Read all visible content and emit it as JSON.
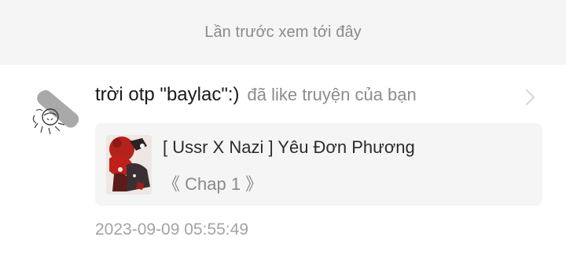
{
  "divider": {
    "last_seen_label": "Lần trước xem tới đây"
  },
  "notification": {
    "username": "trời otp \"baylac\":)",
    "action": "đã like truyện của bạn",
    "avatar_icon": "sketch-avatar-icon",
    "chevron_icon": "chevron-right-icon",
    "story": {
      "title": "[ Ussr X Nazi ] Yêu Đơn Phương",
      "chapter": "《 Chap 1 》",
      "cover_icon": "story-cover-image"
    },
    "timestamp": "2023-09-09 05:55:49"
  },
  "colors": {
    "divider_bg": "#f5f5f5",
    "card_bg": "#f5f5f5",
    "primary_text": "#1a1a1a",
    "secondary_text": "#8a8a8a",
    "cover_accent": "#c0201a"
  }
}
